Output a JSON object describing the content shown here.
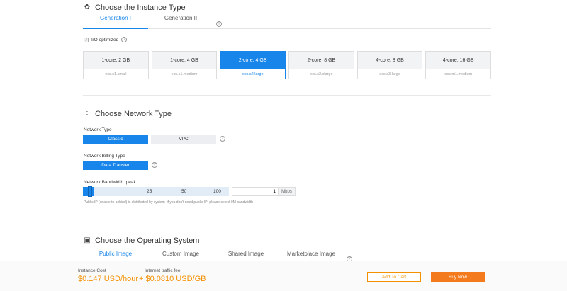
{
  "instance": {
    "title": "Choose the Instance Type",
    "tabs": [
      "Generation I",
      "Generation II"
    ],
    "io_label": "I/O optimized",
    "cards": [
      {
        "spec": "1-core, 2 GB",
        "name": "ecs.s1.small"
      },
      {
        "spec": "1-core, 4 GB",
        "name": "ecs.s1.medium"
      },
      {
        "spec": "2-core, 4 GB",
        "name": "ecs.s2.large"
      },
      {
        "spec": "2-core, 8 GB",
        "name": "ecs.s2.xlarge"
      },
      {
        "spec": "4-core, 8 GB",
        "name": "ecs.s3.large"
      },
      {
        "spec": "4-core, 16 GB",
        "name": "ecs.m1.medium"
      }
    ]
  },
  "network": {
    "title": "Choose Network Type",
    "type_label": "Network Type",
    "type_options": [
      "Classic",
      "VPC"
    ],
    "billing_label": "Network Billing Type",
    "billing_option": "Data Transfer",
    "bandwidth_label": "Network Bandwidth :peak ",
    "slider_marks": [
      "25",
      "50",
      "100"
    ],
    "bandwidth_value": "1",
    "bandwidth_unit": "Mbps",
    "note": "Public IP (unable to unbind) is distributed by system  if you don't need public IP  please select 0M bandwidth"
  },
  "os": {
    "title": "Choose the Operating System",
    "tabs": [
      "Public Image",
      "Custom Image",
      "Shared Image",
      "Marketplace Image"
    ]
  },
  "footer": {
    "instance_cost_label": "Instance Cost",
    "instance_cost": "$0.147 USD/hour",
    "traffic_label": "Internet traffic fee",
    "traffic_fee": "+ $0.0810 USD/GB",
    "add_to_cart": "Add To Cart",
    "buy_now": "Buy Now"
  },
  "colors": {
    "accent": "#1785e9",
    "price": "#f39000",
    "buy": "#f37b1d"
  }
}
